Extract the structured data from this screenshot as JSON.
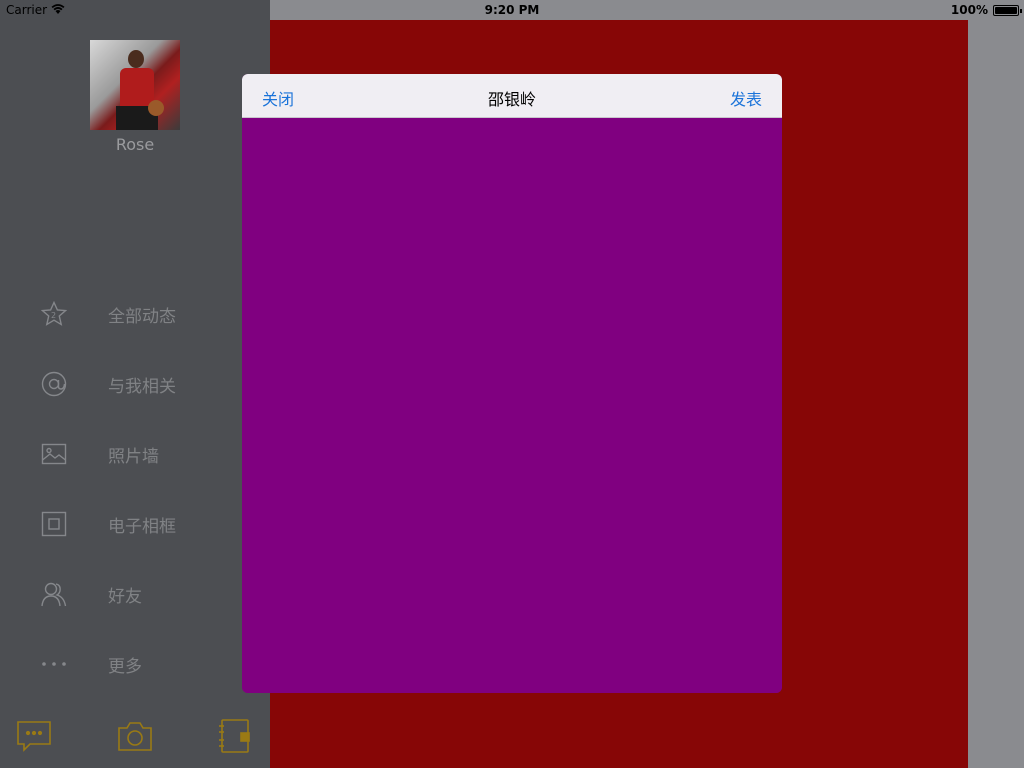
{
  "status_bar": {
    "carrier": "Carrier",
    "time": "9:20 PM",
    "battery": "100%"
  },
  "sidebar": {
    "username": "Rose",
    "items": [
      {
        "label": "全部动态",
        "icon": "star-icon"
      },
      {
        "label": "与我相关",
        "icon": "at-icon"
      },
      {
        "label": "照片墙",
        "icon": "picture-icon"
      },
      {
        "label": "电子相框",
        "icon": "frame-icon"
      },
      {
        "label": "好友",
        "icon": "friends-icon"
      },
      {
        "label": "更多",
        "icon": "more-icon"
      }
    ],
    "bottom_icons": [
      "message-icon",
      "camera-icon",
      "contacts-icon"
    ]
  },
  "modal": {
    "close_label": "关闭",
    "title": "邵银岭",
    "post_label": "发表"
  },
  "colors": {
    "sidebar_bg": "#4c4e52",
    "main_bg": "#870606",
    "modal_body": "#800080",
    "modal_header": "#f0eef3",
    "accent_blue": "#1a73d9",
    "bottom_icon": "#9a7a14"
  }
}
